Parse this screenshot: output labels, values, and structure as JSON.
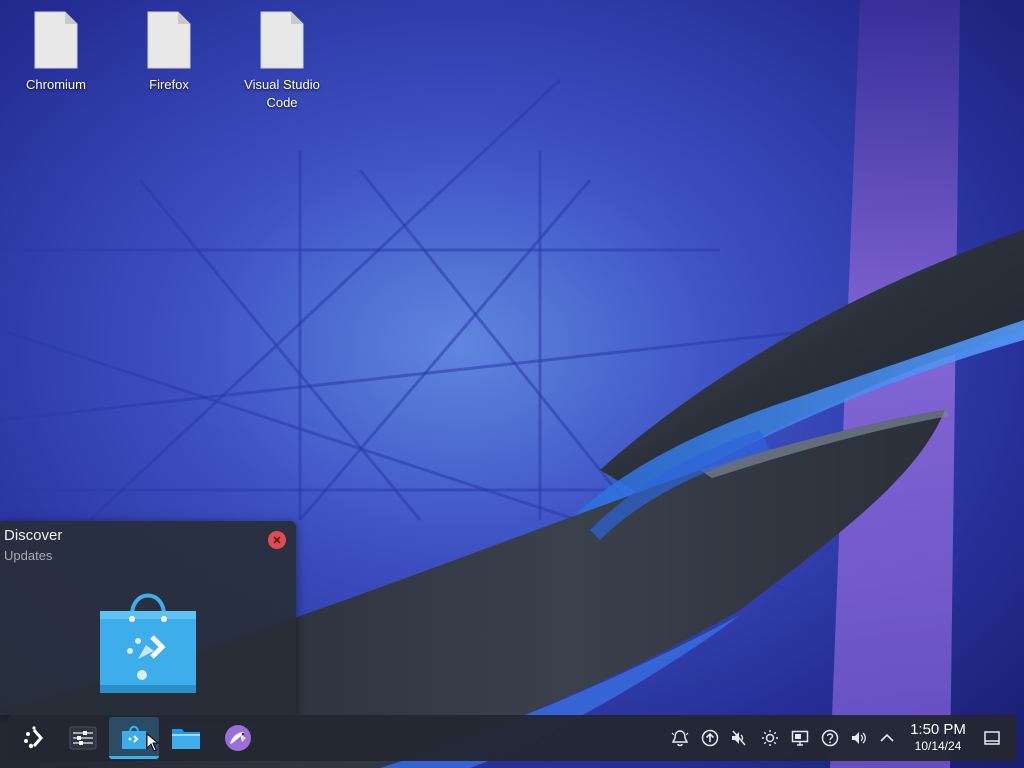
{
  "desktop": {
    "icons": [
      {
        "label": "Chromium",
        "icon": "file-icon"
      },
      {
        "label": "Firefox",
        "icon": "file-icon"
      },
      {
        "label": "Visual Studio Code",
        "icon": "file-icon"
      }
    ]
  },
  "preview": {
    "title": "Discover",
    "subtitle": "Updates",
    "close_icon": "close-icon",
    "thumbnail_icon": "discover-store-icon"
  },
  "taskbar": {
    "launchers": [
      {
        "name": "application-launcher",
        "icon": "kde-launcher-icon"
      },
      {
        "name": "system-settings",
        "icon": "settings-sliders-icon"
      },
      {
        "name": "discover",
        "icon": "shopping-bag-icon",
        "active": true
      },
      {
        "name": "dolphin",
        "icon": "folder-icon"
      },
      {
        "name": "kdeconnect-bird",
        "icon": "bird-icon"
      }
    ],
    "tray": [
      {
        "name": "notifications",
        "icon": "bell-icon"
      },
      {
        "name": "updates",
        "icon": "update-arrow-icon"
      },
      {
        "name": "audio-muted",
        "icon": "speaker-muted-icon"
      },
      {
        "name": "brightness",
        "icon": "sun-icon"
      },
      {
        "name": "display",
        "icon": "monitor-icon"
      },
      {
        "name": "help",
        "icon": "question-icon"
      },
      {
        "name": "volume",
        "icon": "speaker-icon"
      },
      {
        "name": "tray-expand",
        "icon": "chevron-up-icon"
      }
    ],
    "clock": {
      "time": "1:50 PM",
      "date": "10/14/24"
    },
    "show_desktop_icon": "show-desktop-icon"
  },
  "colors": {
    "accent": "#3daee9",
    "panel": "#232832",
    "close": "#e04c53"
  }
}
